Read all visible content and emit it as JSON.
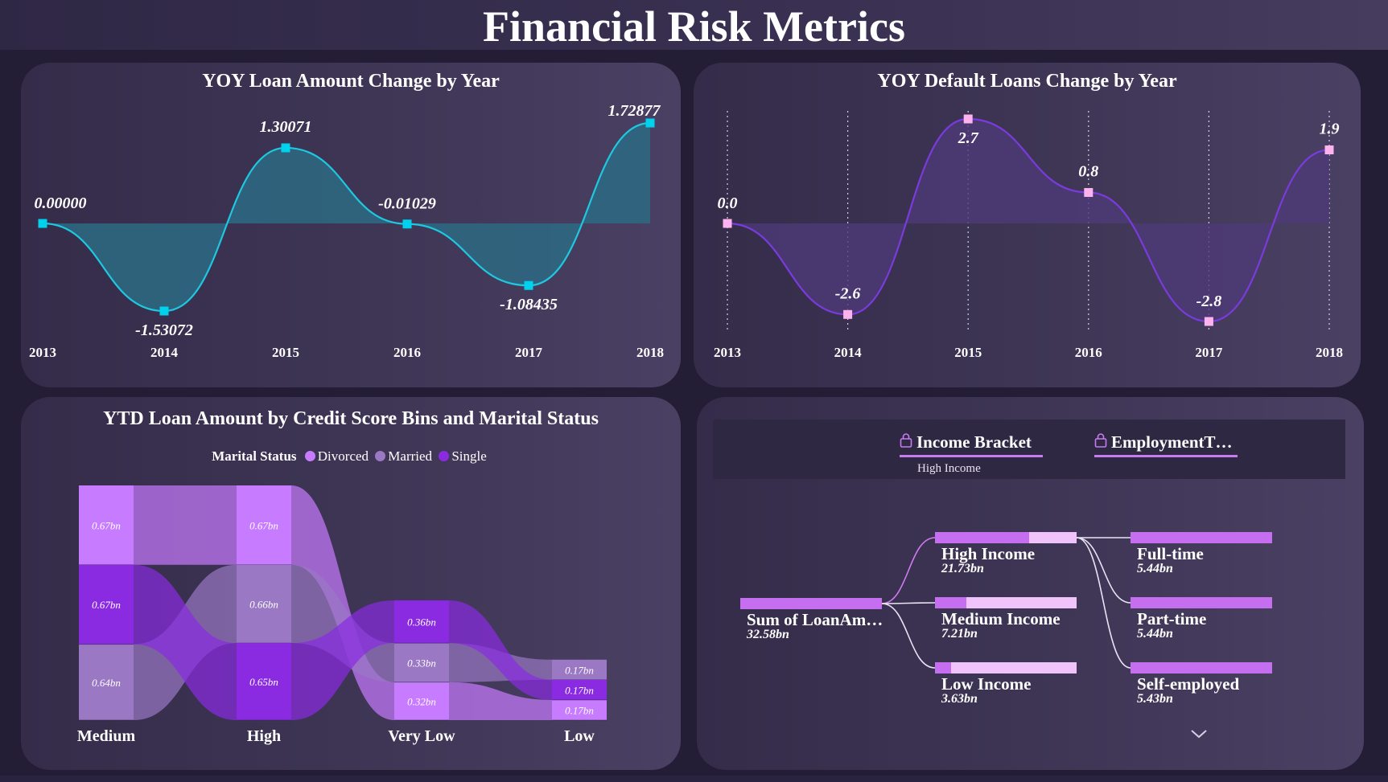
{
  "page": {
    "title": "Financial Risk Metrics"
  },
  "colors": {
    "cyan": "#1ec8e0",
    "cyan_fill": "#2d6a83",
    "purple": "#7a3bdc",
    "purple_fill": "#4d3a78",
    "pink_marker": "#ffb3ee",
    "divorced": "#c77bff",
    "married": "#9a78c4",
    "single": "#8a2be2",
    "bar_fill": "#c56ff0",
    "bar_track": "#f0c4fb"
  },
  "chart_data": [
    {
      "type": "area",
      "title": "YOY Loan Amount Change by Year",
      "x": [
        "2013",
        "2014",
        "2015",
        "2016",
        "2017",
        "2018"
      ],
      "values": [
        0.0,
        -1.53072,
        1.30071,
        -0.01029,
        -1.08435,
        1.72877
      ],
      "labels": [
        "0.00000",
        "-1.53072",
        "1.30071",
        "-0.01029",
        "-1.08435",
        "1.72877"
      ],
      "ylim": [
        -1.53072,
        1.72877
      ],
      "grid": false,
      "smooth": true
    },
    {
      "type": "area",
      "title": "YOY Default Loans Change by Year",
      "x": [
        "2013",
        "2014",
        "2015",
        "2016",
        "2017",
        "2018"
      ],
      "values": [
        0.0,
        -2.6,
        2.7,
        0.8,
        -2.8,
        1.9
      ],
      "labels": [
        "0.0",
        "-2.6",
        "2.7",
        "0.8",
        "-2.8",
        "1.9"
      ],
      "ylim": [
        -2.8,
        2.7
      ],
      "grid": "vertical-dotted",
      "smooth": true
    },
    {
      "type": "ribbon",
      "title": "YTD Loan Amount by Credit Score Bins and Marital Status",
      "legend_title": "Marital Status",
      "legend_position": "top",
      "unit": "bn",
      "categories": [
        "Medium",
        "High",
        "Very Low",
        "Low"
      ],
      "series": [
        {
          "name": "Divorced",
          "values": [
            0.67,
            0.67,
            0.32,
            0.17
          ],
          "labels": [
            "0.67bn",
            "0.67bn",
            "0.32bn",
            "0.17bn"
          ]
        },
        {
          "name": "Married",
          "values": [
            0.64,
            0.66,
            0.33,
            0.17
          ],
          "labels": [
            "0.64bn",
            "0.66bn",
            "0.33bn",
            "0.17bn"
          ]
        },
        {
          "name": "Single",
          "values": [
            0.67,
            0.65,
            0.36,
            0.17
          ],
          "labels": [
            "0.67bn",
            "0.65bn",
            "0.36bn",
            "0.17bn"
          ]
        }
      ],
      "stack_order": [
        [
          "Divorced",
          "Single",
          "Married"
        ],
        [
          "Divorced",
          "Married",
          "Single"
        ],
        [
          "Single",
          "Married",
          "Divorced"
        ],
        [
          "Married",
          "Single",
          "Divorced"
        ]
      ]
    },
    {
      "type": "decomposition-tree",
      "root": {
        "label": "Sum of LoanAm…",
        "value": "32.58bn",
        "amount": 32.58
      },
      "levels": [
        {
          "header": "Income Bracket",
          "selected": "High Income",
          "locked": true,
          "items": [
            {
              "label": "High Income",
              "value": "21.73bn",
              "amount": 21.73
            },
            {
              "label": "Medium Income",
              "value": "7.21bn",
              "amount": 7.21
            },
            {
              "label": "Low Income",
              "value": "3.63bn",
              "amount": 3.63
            }
          ]
        },
        {
          "header": "EmploymentT…",
          "locked": true,
          "items": [
            {
              "label": "Full-time",
              "value": "5.44bn",
              "amount": 5.44
            },
            {
              "label": "Part-time",
              "value": "5.44bn",
              "amount": 5.44
            },
            {
              "label": "Self-employed",
              "value": "5.43bn",
              "amount": 5.43
            }
          ]
        }
      ]
    }
  ]
}
